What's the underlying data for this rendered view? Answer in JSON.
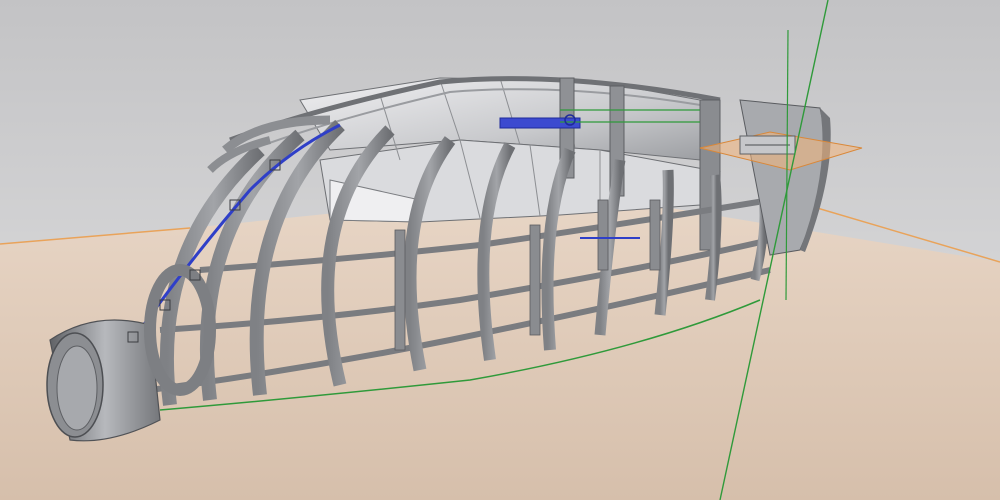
{
  "viewport": {
    "scene": "cad-3d-viewport",
    "background_colors": {
      "sky_top": "#c4c4c6",
      "sky_bottom": "#dededf",
      "ground_near": "#dcc6b4",
      "ground_far": "#e6d3c3",
      "ground_edge": "#e8a45c"
    },
    "model": {
      "frame_color": "#8e9094",
      "frame_dark": "#55575b",
      "skin_light": "#dedfe2",
      "skin_mid": "#a9abaf",
      "highlight_blue": "#2f3fc8",
      "ref_plane_orange": "#f4b47a",
      "axis_green": "#2f9a3a"
    }
  }
}
